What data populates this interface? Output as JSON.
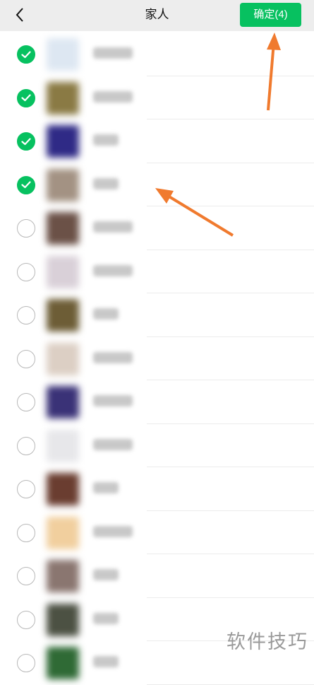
{
  "header": {
    "title": "家人",
    "confirm_label": "确定(4)",
    "back_icon": "chevron-left-icon"
  },
  "contacts": [
    {
      "selected": true,
      "avatar_color": "#dde7f2"
    },
    {
      "selected": true,
      "avatar_color": "#8a7a44"
    },
    {
      "selected": true,
      "avatar_color": "#2f2a86"
    },
    {
      "selected": true,
      "avatar_color": "#a39283"
    },
    {
      "selected": false,
      "avatar_color": "#6b5147"
    },
    {
      "selected": false,
      "avatar_color": "#d9d0d8"
    },
    {
      "selected": false,
      "avatar_color": "#6d5d36"
    },
    {
      "selected": false,
      "avatar_color": "#dccfc4"
    },
    {
      "selected": false,
      "avatar_color": "#3a3277"
    },
    {
      "selected": false,
      "avatar_color": "#e7e7ea"
    },
    {
      "selected": false,
      "avatar_color": "#6a3d30"
    },
    {
      "selected": false,
      "avatar_color": "#f1cf9e"
    },
    {
      "selected": false,
      "avatar_color": "#8a7670"
    },
    {
      "selected": false,
      "avatar_color": "#4c5143"
    },
    {
      "selected": false,
      "avatar_color": "#2f6a35"
    }
  ],
  "colors": {
    "accent": "#07c160",
    "annotation_arrow": "#f07a2e"
  },
  "watermark": "软件技巧"
}
